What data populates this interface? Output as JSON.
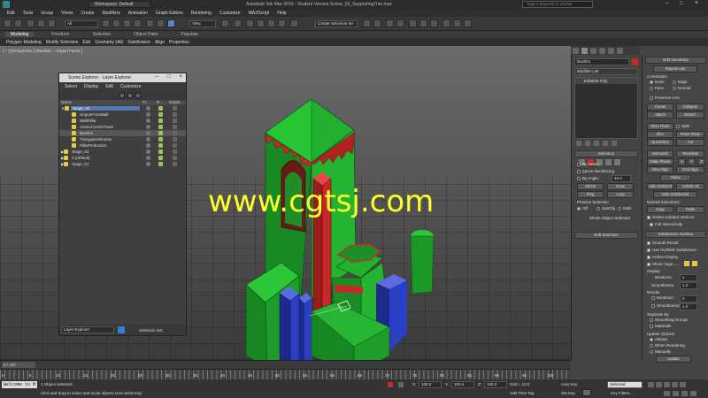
{
  "titlebar": {
    "workspace": "Workspace: Default",
    "title": "Autodesk 3ds Max 2015   -  Student Version     Scene_03_SupportingTrim.max",
    "search_placeholder": "Type a keyword or phrase"
  },
  "menu": [
    "Edit",
    "Tools",
    "Group",
    "Views",
    "Create",
    "Modifiers",
    "Animation",
    "Graph Editors",
    "Rendering",
    "Customize",
    "MAXScript",
    "Help"
  ],
  "toolbar": {
    "selection_filter": "All",
    "view": "View",
    "named_set": "Create Selection Se"
  },
  "ribbon": {
    "tabs": [
      "Modeling",
      "Freeform",
      "Selection",
      "Object Paint",
      "Populate"
    ],
    "sub": [
      "Polygon Modeling",
      "Modify Selection",
      "Edit",
      "Geometry (All)",
      "Subdivision",
      "Align",
      "Properties"
    ]
  },
  "viewport": {
    "label": "[ + ] [Perspective ] [Realistic + Edged Faces ]"
  },
  "explorer": {
    "title": "Scene Explorer - Layer Explorer",
    "menu": [
      "Select",
      "Display",
      "Edit",
      "Customize"
    ],
    "col_name": "Name",
    "col_f": "Fr...",
    "col_r": "R...",
    "col_d": "Disple...",
    "rows": [
      {
        "name": "Stage_02",
        "indent": 0,
        "sel": true
      },
      {
        "name": "UnqueFrontWall",
        "indent": 2
      },
      {
        "name": "WallPillar",
        "indent": 2
      },
      {
        "name": "AnnexCornerTower",
        "indent": 2
      },
      {
        "name": "Box001",
        "indent": 2
      },
      {
        "name": "TriangularWindow",
        "indent": 2
      },
      {
        "name": "PillarProtrusion",
        "indent": 2
      },
      {
        "name": "Stage_03",
        "indent": 0
      },
      {
        "name": "0 (default)",
        "indent": 0
      },
      {
        "name": "Stage_01",
        "indent": 0
      }
    ],
    "footer_dropdown": "Layer Explorer",
    "footer_label": "Selection Set:"
  },
  "watermark": "www.cgtsj.com",
  "modify": {
    "object_name": "Box001",
    "modifier_list": "Modifier List",
    "stack_item": "Editable Poly",
    "selection_header": "Selection",
    "by_vertex": "By Vertex",
    "ignore_backfacing": "Ignore Backfacing",
    "by_angle": "By Angle:",
    "angle_value": "45.0",
    "shrink": "Shrink",
    "grow": "Grow",
    "ring": "Ring",
    "loop": "Loop",
    "preview_sel": "Preview Selection",
    "off": "Off",
    "subobj": "SubObj",
    "multi": "Multi",
    "whole_object": "Whole Object Selected",
    "soft_selection": "Soft Selection"
  },
  "edit_geometry": {
    "header": "Edit Geometry",
    "repeat_last": "Repeat Last",
    "constraints": "Constraints",
    "none": "None",
    "edge": "Edge",
    "face": "Face",
    "normal": "Normal",
    "preserve_uvs": "Preserve UVs",
    "create": "Create",
    "collapse": "Collapse",
    "attach": "Attach",
    "detach": "Detach",
    "slice_plane": "Slice Plane",
    "split": "Split",
    "slice": "Slice",
    "reset_plane": "Reset Plane",
    "quickslice": "QuickSlice",
    "cut": "Cut",
    "msmooth": "MSmooth",
    "tessellate": "Tessellate",
    "make_planar": "Make Planar",
    "x": "X",
    "y": "Y",
    "z": "Z",
    "view_align": "View Align",
    "grid_align": "Grid Align",
    "relax": "Relax",
    "hide_selected": "Hide Selected",
    "unhide_all": "Unhide All",
    "hide_unselected": "Hide Unselected",
    "named_selections": "Named Selections:",
    "copy": "Copy",
    "paste": "Paste",
    "delete_isolated": "Delete Isolated Vertices",
    "full_interactivity": "Full Interactivity"
  },
  "subdivision": {
    "header": "Subdivision Surface",
    "smooth_result": "Smooth Result",
    "use_nurms": "Use NURMS Subdivision",
    "isoline": "Isoline Display",
    "show_cage": "Show Cage......",
    "display": "Display",
    "iterations_label": "Iterations:",
    "iterations": "1",
    "smoothness_label": "Smoothness:",
    "smoothness": "1.0",
    "render": "Render",
    "r_iterations": "0",
    "r_smoothness": "1.0",
    "separate_by": "Separate By",
    "smoothing_groups": "Smoothing Groups",
    "materials": "Materials",
    "update_options": "Update Options",
    "always": "Always",
    "when_rendering": "When Rendering",
    "manually": "Manually",
    "update": "Update",
    "displacement": "Subdivision Displacement"
  },
  "timeline": {
    "slider": "0 / 100",
    "ticks": [
      "0",
      "5",
      "10",
      "15",
      "20",
      "25",
      "30",
      "35",
      "40",
      "45",
      "50",
      "55",
      "60",
      "65",
      "70",
      "75",
      "80",
      "85",
      "90",
      "95",
      "100"
    ]
  },
  "status": {
    "maxscript": "Welcome to M",
    "selected": "1 Object Selected",
    "prompt": "Click and drag to select and scale objects (non-uniformly)",
    "x_label": "X:",
    "x": "100.0",
    "y_label": "Y:",
    "y": "100.0",
    "z_label": "Z:",
    "z": "100.0",
    "grid": "Grid = 10.0",
    "add_time_tag": "Add Time Tag",
    "auto_key": "Auto Key",
    "set_key": "Set Key",
    "selected_mode": "Selected",
    "key_filters": "Key Filters..."
  },
  "colors": {
    "green": "#22b12e",
    "blue": "#2b3fc4",
    "red": "#c62a28",
    "dark_red": "#6a1919",
    "watermark": "#ffff2a",
    "selection": "#5377b3"
  }
}
